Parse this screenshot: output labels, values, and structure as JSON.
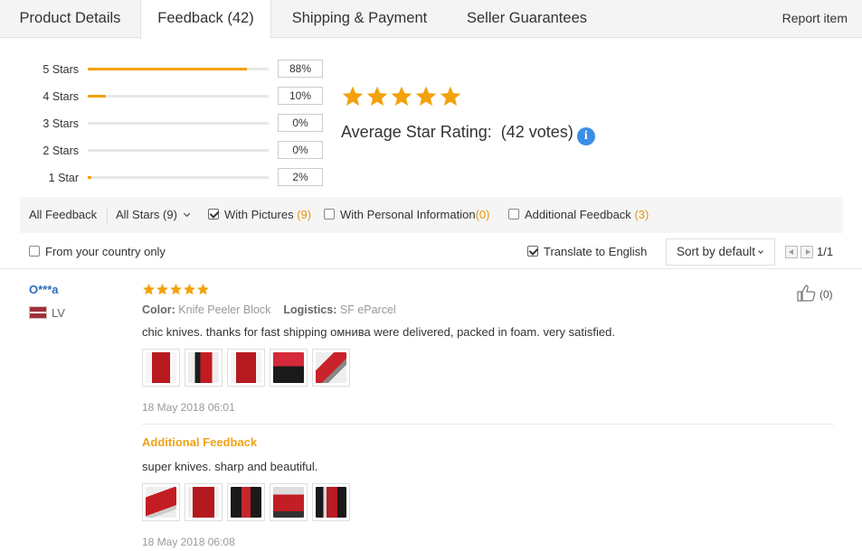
{
  "tabs": [
    {
      "label": "Product Details",
      "active": false
    },
    {
      "label": "Feedback (42)",
      "active": true
    },
    {
      "label": "Shipping & Payment",
      "active": false
    },
    {
      "label": "Seller Guarantees",
      "active": false
    }
  ],
  "report_label": "Report item",
  "rating_breakdown": [
    {
      "label": "5 Stars",
      "percent_text": "88%",
      "percent": 88
    },
    {
      "label": "4 Stars",
      "percent_text": "10%",
      "percent": 10
    },
    {
      "label": "3 Stars",
      "percent_text": "0%",
      "percent": 0
    },
    {
      "label": "2 Stars",
      "percent_text": "0%",
      "percent": 0
    },
    {
      "label": "1 Star",
      "percent_text": "2%",
      "percent": 2
    }
  ],
  "summary": {
    "stars": 5,
    "label": "Average Star Rating:",
    "votes": "(42 votes)",
    "info_glyph": "i"
  },
  "filters": {
    "all_feedback": "All Feedback",
    "all_stars": "All Stars (9)",
    "with_pictures": {
      "label": "With Pictures",
      "count": "(9)",
      "checked": true
    },
    "with_personal": {
      "label": "With Personal Information",
      "count": "(0)",
      "checked": false
    },
    "additional": {
      "label": "Additional Feedback",
      "count": "(3)",
      "checked": false
    }
  },
  "options": {
    "country_only": {
      "label": "From your country only",
      "checked": false
    },
    "translate": {
      "label": "Translate to English",
      "checked": true
    },
    "sort_label": "Sort by default",
    "page": "1/1"
  },
  "review": {
    "user": "O***a",
    "country": "LV",
    "stars": 5,
    "color_label": "Color:",
    "color_value": "Knife Peeler Block",
    "logistics_label": "Logistics:",
    "logistics_value": "SF eParcel",
    "text": "chic knives. thanks for fast shipping омнива were delivered, packed in foam. very satisfied.",
    "date": "18 May 2018 06:01",
    "helpful_count": "(0)",
    "additional": {
      "title": "Additional Feedback",
      "text": "super knives. sharp and beautiful.",
      "date": "18 May 2018 06:08"
    }
  },
  "colors": {
    "accent_star": "#f2a20c",
    "link_blue": "#2a6ebb",
    "additional_orange": "#f0a21a"
  }
}
